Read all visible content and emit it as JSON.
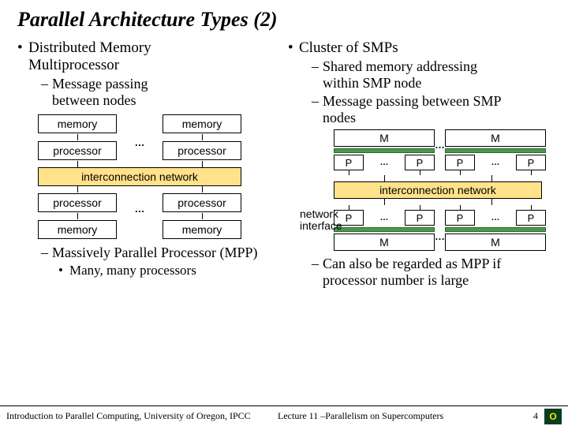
{
  "title": "Parallel Architecture Types (2)",
  "left": {
    "h1a": "Distributed Memory",
    "h1b": "Multiprocessor",
    "s1a": "Message passing",
    "s1b": "between nodes",
    "post1": "Massively Parallel Processor (MPP)",
    "post2": "Many, many processors"
  },
  "right": {
    "h1": "Cluster of SMPs",
    "s1a": "Shared memory addressing",
    "s1b": "within SMP node",
    "s2a": "Message passing between SMP",
    "s2b": "nodes",
    "post1a": "Can also be regarded as MPP if",
    "post1b": "processor number is large"
  },
  "diag": {
    "memory": "memory",
    "processor": "processor",
    "inter": "interconnection network",
    "ell": "…",
    "M": "M",
    "P": "P",
    "niA": "network",
    "niB": "interface"
  },
  "footer": {
    "left": "Introduction to Parallel Computing, University of Oregon, IPCC",
    "mid": "Lecture 11 –Parallelism on Supercomputers",
    "num": "4",
    "logo": "O"
  }
}
